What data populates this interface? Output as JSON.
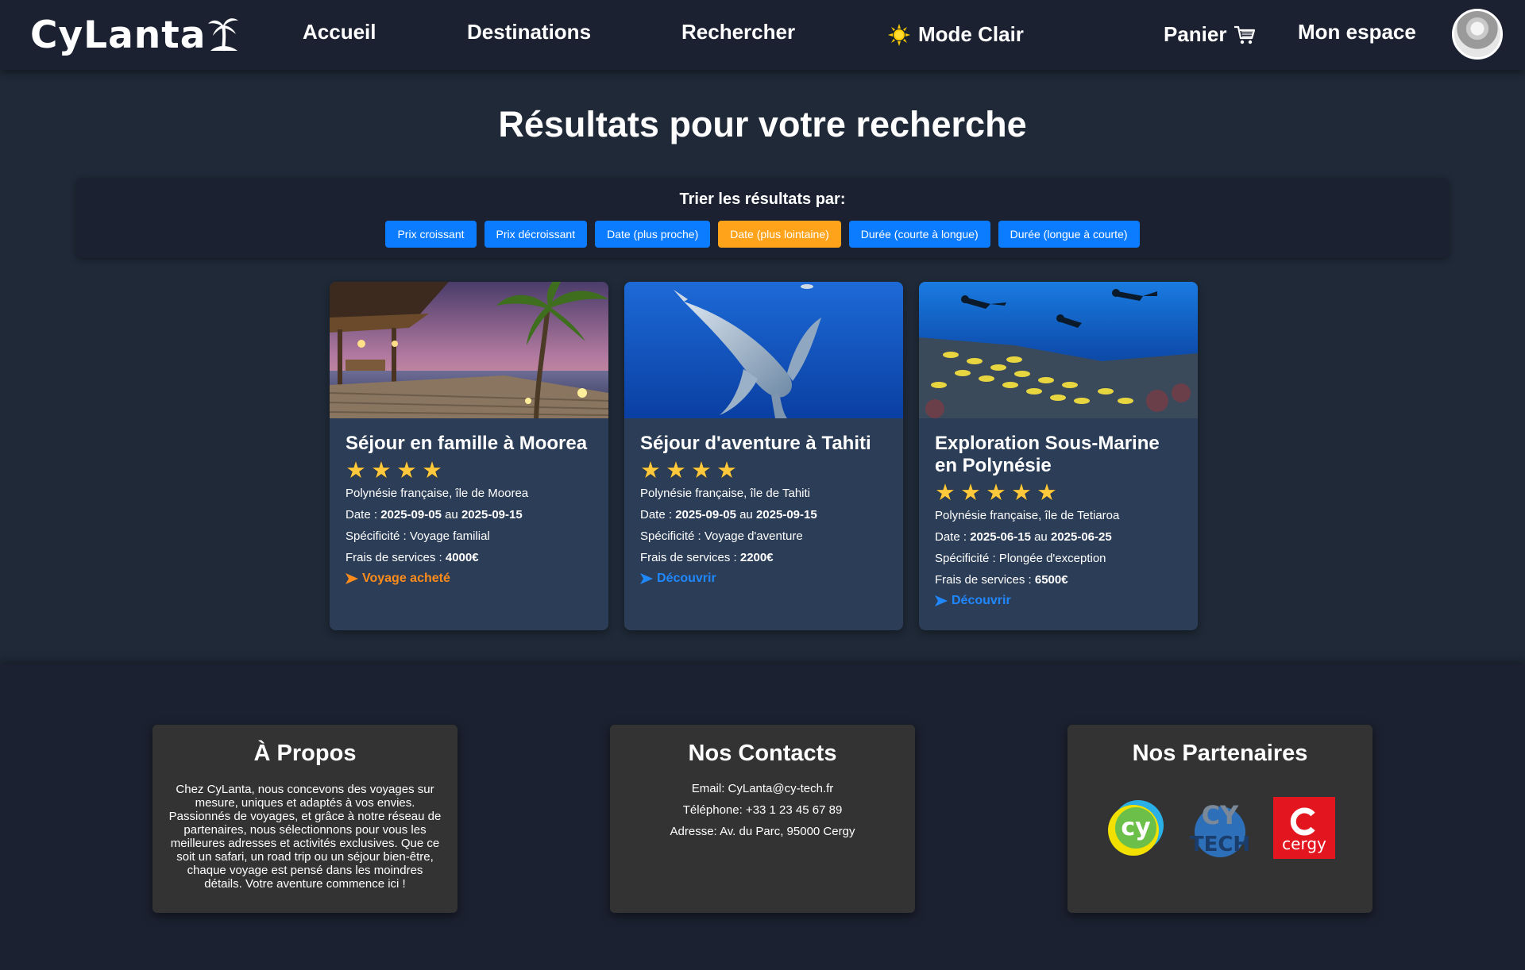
{
  "nav": {
    "logo_text": "CyLanta",
    "accueil": "Accueil",
    "destinations": "Destinations",
    "rechercher": "Rechercher",
    "mode": "Mode Clair",
    "panier": "Panier",
    "espace": "Mon espace",
    "icons": {
      "logo": "palm-tree-icon",
      "mode": "sun-icon",
      "panier": "cart-icon"
    }
  },
  "page_title": "Résultats pour votre recherche",
  "sort": {
    "label": "Trier les résultats par:",
    "buttons": [
      {
        "label": "Prix croissant",
        "active": false
      },
      {
        "label": "Prix décroissant",
        "active": false
      },
      {
        "label": "Date (plus proche)",
        "active": false
      },
      {
        "label": "Date (plus lointaine)",
        "active": true
      },
      {
        "label": "Durée (courte à longue)",
        "active": false
      },
      {
        "label": "Durée (longue à courte)",
        "active": false
      }
    ]
  },
  "cards": [
    {
      "title": "Séjour en famille à Moorea",
      "rating": 4,
      "location": "Polynésie française, île de Moorea",
      "date_prefix": "Date : ",
      "date_start": "2025-09-05",
      "date_sep": " au ",
      "date_end": "2025-09-15",
      "spec": "Spécificité : Voyage familial",
      "fees_prefix": "Frais de services : ",
      "fees": "4000€",
      "link": "Voyage acheté",
      "link_bought": true
    },
    {
      "title": "Séjour d'aventure à Tahiti",
      "rating": 4,
      "location": "Polynésie française, île de Tahiti",
      "date_prefix": "Date : ",
      "date_start": "2025-09-05",
      "date_sep": " au ",
      "date_end": "2025-09-15",
      "spec": "Spécificité : Voyage d'aventure",
      "fees_prefix": "Frais de services : ",
      "fees": "2200€",
      "link": "Découvrir",
      "link_bought": false
    },
    {
      "title": "Exploration Sous-Marine en Polynésie",
      "rating": 5,
      "location": "Polynésie française, île de Tetiaroa",
      "date_prefix": "Date : ",
      "date_start": "2025-06-15",
      "date_sep": " au ",
      "date_end": "2025-06-25",
      "spec": "Spécificité : Plongée d'exception",
      "fees_prefix": "Frais de services : ",
      "fees": "6500€",
      "link": "Découvrir",
      "link_bought": false
    }
  ],
  "footer": {
    "about": {
      "title": "À Propos",
      "text": "Chez CyLanta, nous concevons des voyages sur mesure, uniques et adaptés à vos envies. Passionnés de voyages, et grâce à notre réseau de partenaires, nous sélectionnons pour vous les meilleures adresses et activités exclusives. Que ce soit un safari, un road trip ou un séjour bien-être, chaque voyage est pensé dans les moindres détails. Votre aventure commence ici !"
    },
    "contact": {
      "title": "Nos Contacts",
      "email": "Email: CyLanta@cy-tech.fr",
      "phone": "Téléphone: +33 1 23 45 67 89",
      "address": "Adresse: Av. du Parc, 95000 Cergy"
    },
    "partners": {
      "title": "Nos Partenaires",
      "logos": [
        {
          "name": "cy-logo",
          "text": "cy"
        },
        {
          "name": "cy-tech-logo",
          "text_top": "CY",
          "text_bottom": "TECH"
        },
        {
          "name": "cergy-logo",
          "text": "cergy"
        }
      ]
    }
  },
  "colors": {
    "page_bg": "#1f2937",
    "nav_bg": "#1b2130",
    "card_bg": "#2c3e57",
    "button_blue": "#0b7bff",
    "button_active": "#ffa31a",
    "link_blue": "#2088ff",
    "link_bought": "#ff8c1a",
    "star": "#ffc83d",
    "footer_box": "#333333"
  }
}
